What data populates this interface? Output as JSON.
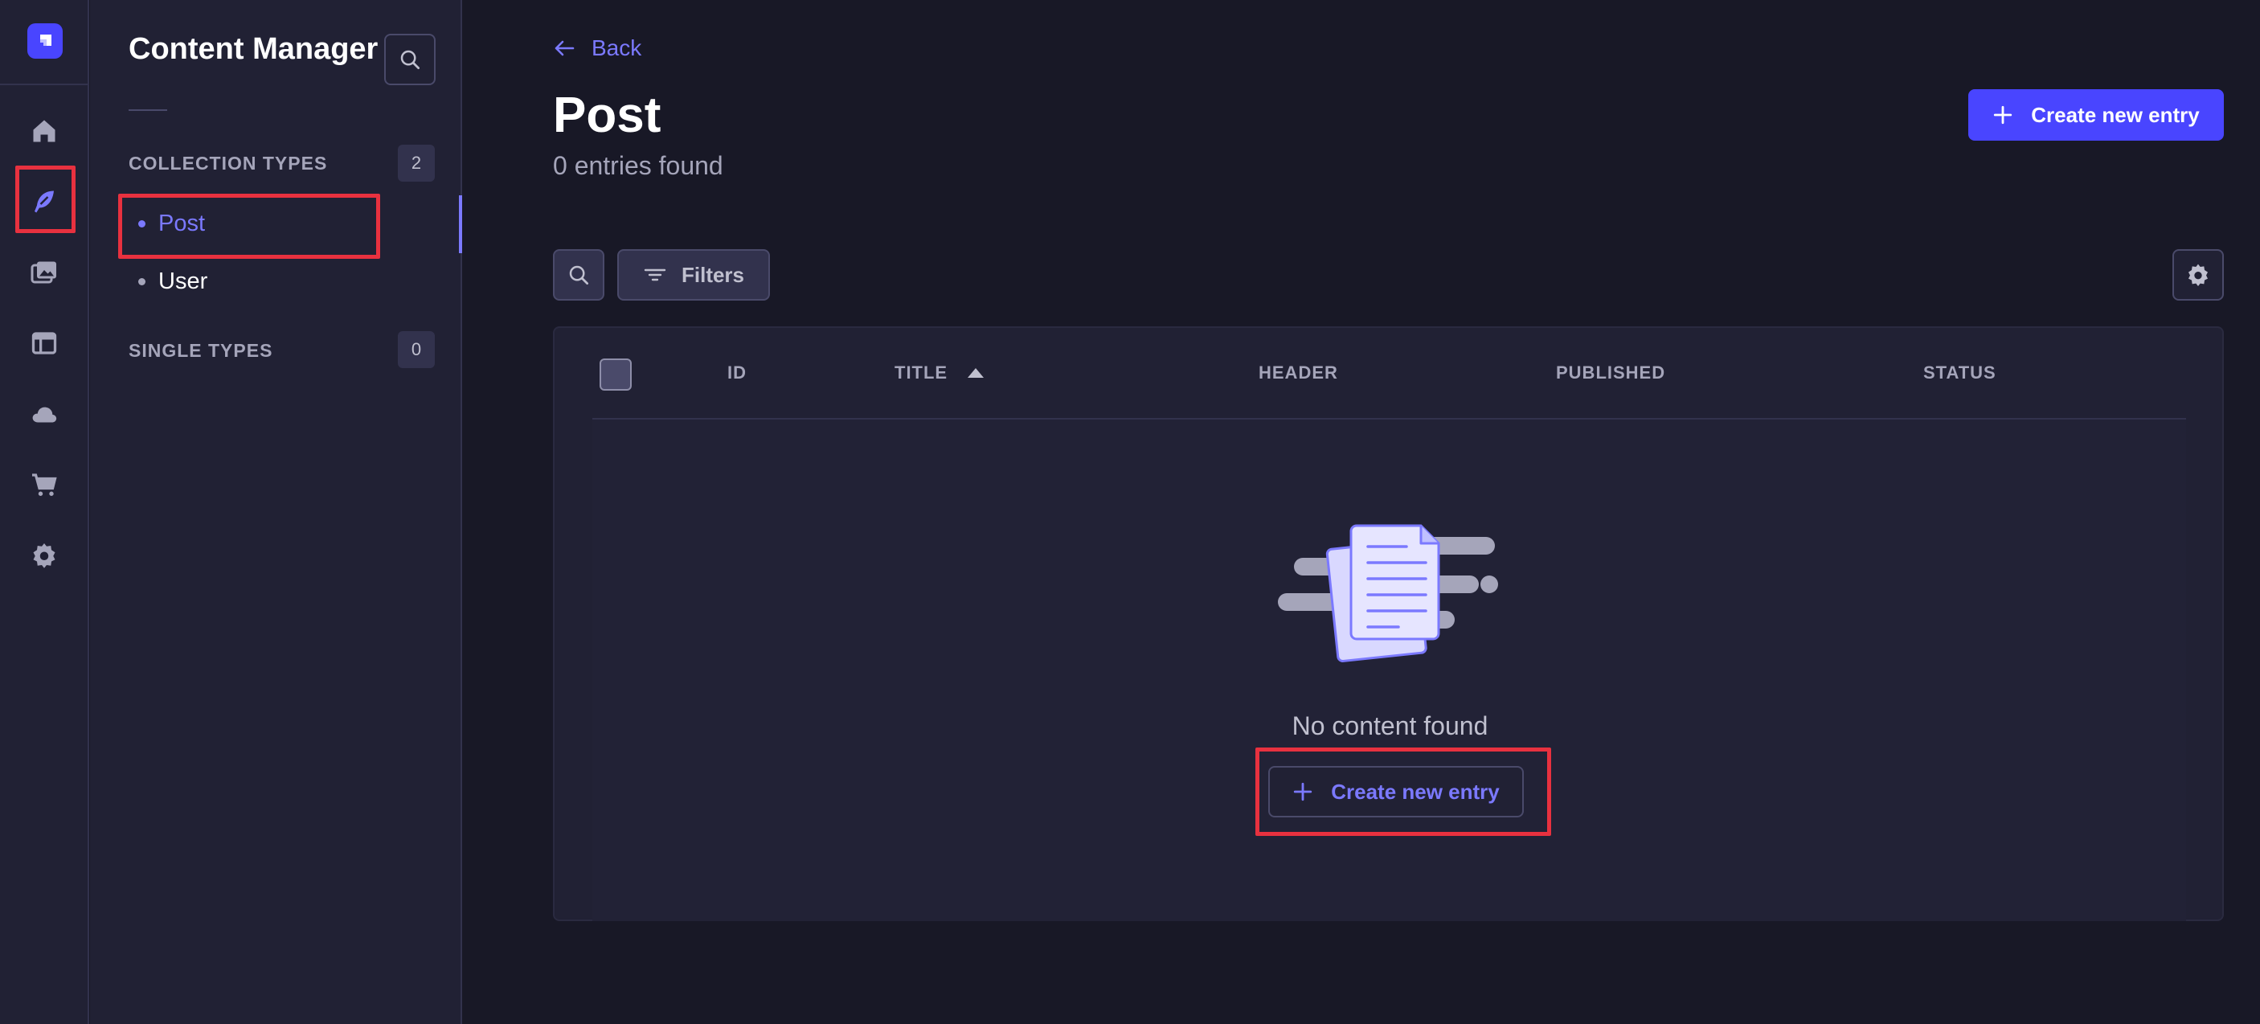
{
  "rail": {
    "items": [
      {
        "name": "home-icon"
      },
      {
        "name": "content-manager-icon",
        "highlighted": true
      },
      {
        "name": "media-library-icon"
      },
      {
        "name": "content-type-builder-icon"
      },
      {
        "name": "cloud-icon"
      },
      {
        "name": "marketplace-cart-icon"
      },
      {
        "name": "settings-gear-icon"
      }
    ]
  },
  "sidenav": {
    "title": "Content Manager",
    "collection_types": {
      "label": "COLLECTION TYPES",
      "count": "2",
      "items": [
        {
          "label": "Post",
          "active": true
        },
        {
          "label": "User",
          "active": false
        }
      ]
    },
    "single_types": {
      "label": "SINGLE TYPES",
      "count": "0"
    }
  },
  "header": {
    "back_label": "Back",
    "title": "Post",
    "subtitle": "0 entries found",
    "create_button_label": "Create new entry"
  },
  "toolbar": {
    "filters_label": "Filters"
  },
  "table": {
    "columns": [
      "ID",
      "TITLE",
      "HEADER",
      "PUBLISHED",
      "STATUS"
    ],
    "sort_column": "TITLE",
    "sort_direction": "ascending",
    "rows": []
  },
  "empty_state": {
    "message": "No content found",
    "button_label": "Create new entry"
  },
  "colors": {
    "background": "#181826",
    "panel": "#212134",
    "primary": "#4945ff",
    "accent_text": "#7b79ff",
    "highlight_box": "#e8313f"
  }
}
